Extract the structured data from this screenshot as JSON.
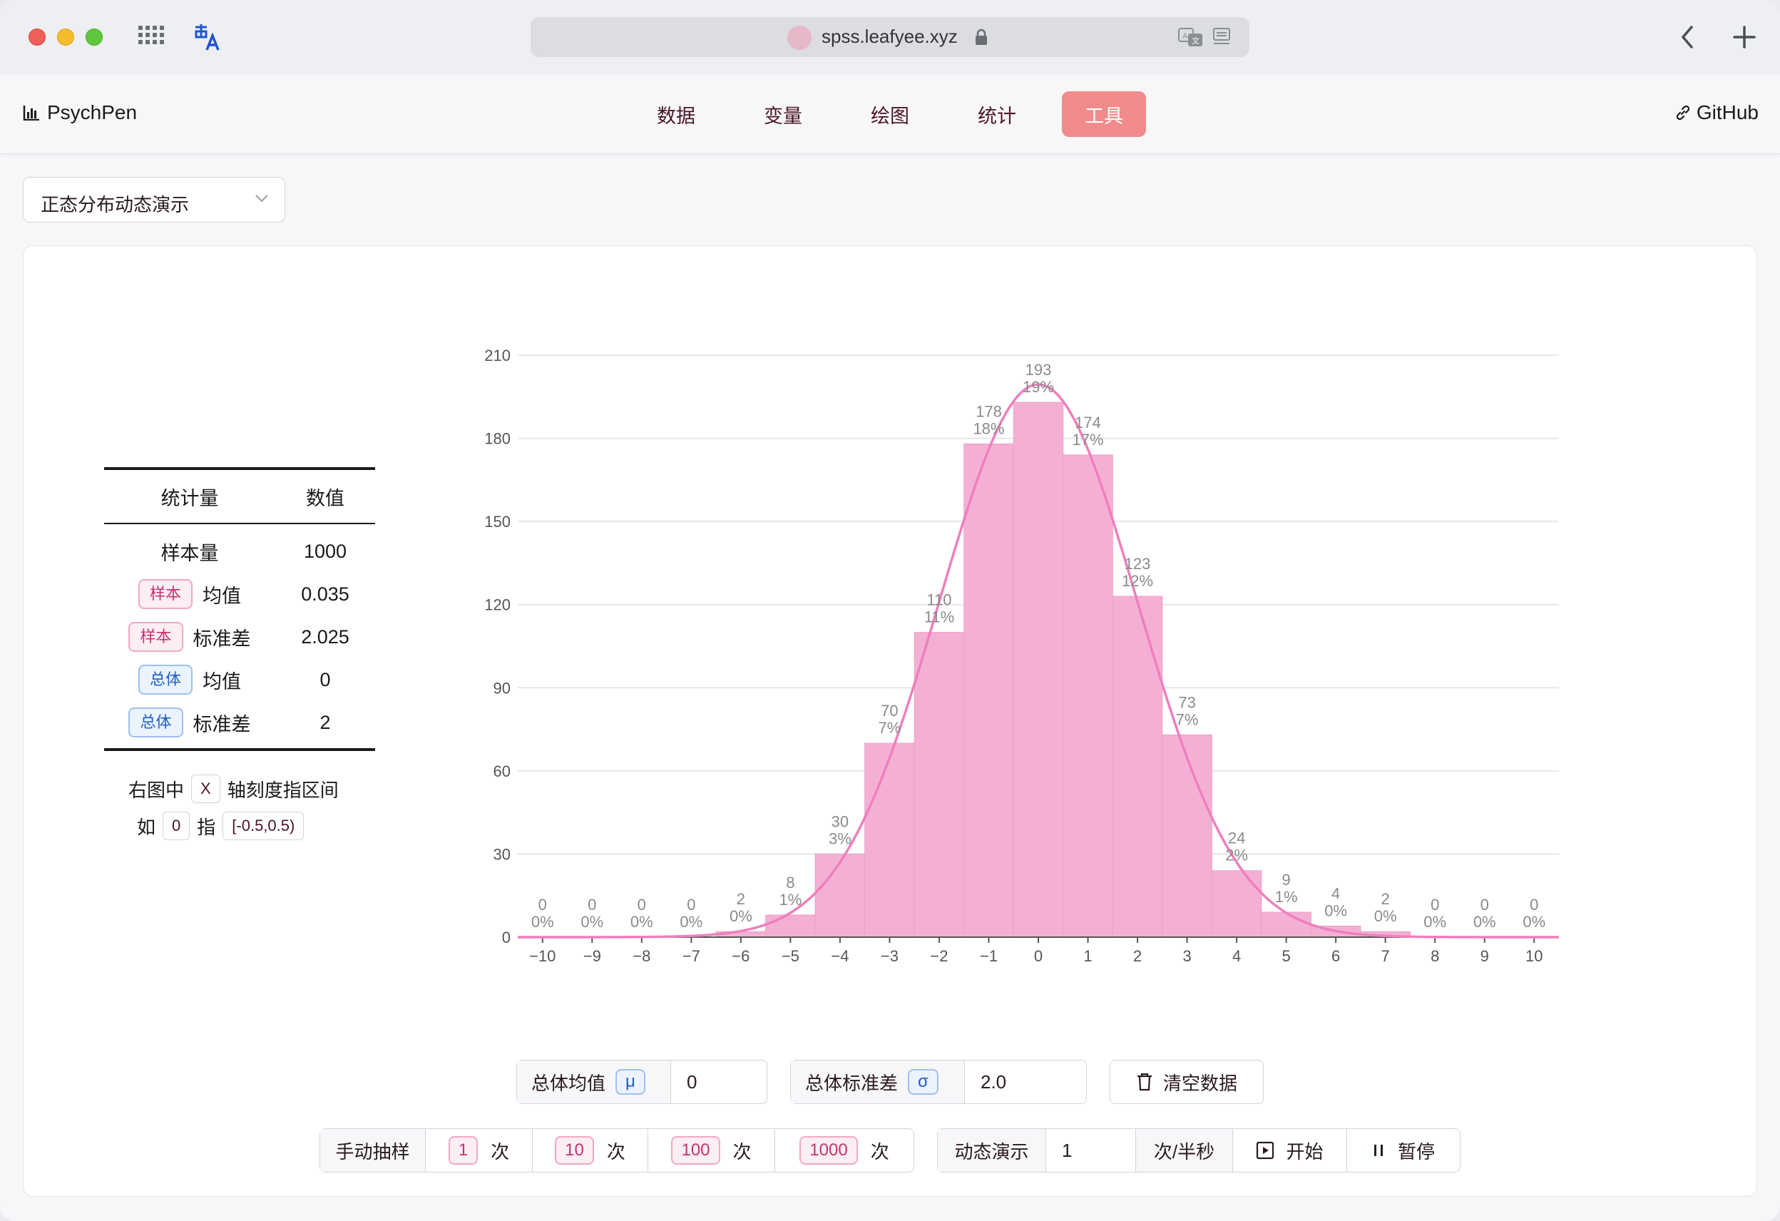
{
  "browser": {
    "url": "spss.leafyee.xyz"
  },
  "app": {
    "brand": "PsychPen",
    "nav": [
      {
        "label": "数据",
        "active": false
      },
      {
        "label": "变量",
        "active": false
      },
      {
        "label": "绘图",
        "active": false
      },
      {
        "label": "统计",
        "active": false
      },
      {
        "label": "工具",
        "active": true
      }
    ],
    "github": "GitHub"
  },
  "tool_select": {
    "value": "正态分布动态演示"
  },
  "stats": {
    "header": {
      "col1": "统计量",
      "col2": "数值"
    },
    "sample_size_label": "样本量",
    "sample_size": "1000",
    "rows": [
      {
        "tag": "样本",
        "tag_color": "#c2336f",
        "label": "均值",
        "value": "0.035"
      },
      {
        "tag": "样本",
        "tag_color": "#c2336f",
        "label": "标准差",
        "value": "2.025"
      },
      {
        "tag": "总体",
        "tag_color": "#1f5fc4",
        "label": "均值",
        "value": "0"
      },
      {
        "tag": "总体",
        "tag_color": "#1f5fc4",
        "label": "标准差",
        "value": "2"
      }
    ],
    "note_line1_a": "右图中",
    "note_line1_key": "X",
    "note_line1_b": "轴刻度指区间",
    "note_line2_a": "如",
    "note_line2_key": "0",
    "note_line2_b": "指",
    "note_line2_interval": "[-0.5,0.5)"
  },
  "chart_data": {
    "type": "bar",
    "categories": [
      -10,
      -9,
      -8,
      -7,
      -6,
      -5,
      -4,
      -3,
      -2,
      -1,
      0,
      1,
      2,
      3,
      4,
      5,
      6,
      7,
      8,
      9,
      10
    ],
    "x_tick_labels": [
      "−10",
      "−9",
      "−8",
      "−7",
      "−6",
      "−5",
      "−4",
      "−3",
      "−2",
      "−1",
      "0",
      "1",
      "2",
      "3",
      "4",
      "5",
      "6",
      "7",
      "8",
      "9",
      "10"
    ],
    "values": [
      0,
      0,
      0,
      0,
      2,
      8,
      30,
      70,
      110,
      178,
      193,
      174,
      123,
      73,
      24,
      9,
      4,
      2,
      0,
      0,
      0
    ],
    "percent_labels": [
      "0%",
      "0%",
      "0%",
      "0%",
      "0%",
      "1%",
      "3%",
      "7%",
      "11%",
      "18%",
      "19%",
      "17%",
      "12%",
      "7%",
      "2%",
      "1%",
      "0%",
      "0%",
      "0%",
      "0%",
      "0%"
    ],
    "ylim": [
      0,
      210
    ],
    "yticks": [
      0,
      30,
      60,
      90,
      120,
      150,
      180,
      210
    ],
    "grid": true,
    "bar_color": "#f4b0d4",
    "curve_color": "#ee7fbd",
    "curve": {
      "type": "normal-density",
      "mean": 0,
      "sd": 2
    }
  },
  "controls": {
    "pop_mean_label": "总体均值",
    "pop_mean_symbol": "μ",
    "pop_mean_value": "0",
    "pop_sd_label": "总体标准差",
    "pop_sd_symbol": "σ",
    "pop_sd_value": "2.0",
    "clear_label": "清空数据",
    "manual_label": "手动抽样",
    "times_unit": "次",
    "sample_buttons": [
      "1",
      "10",
      "100",
      "1000"
    ],
    "anim_label": "动态演示",
    "anim_value": "1",
    "anim_unit": "次/半秒",
    "start_label": "开始",
    "pause_label": "暂停"
  }
}
